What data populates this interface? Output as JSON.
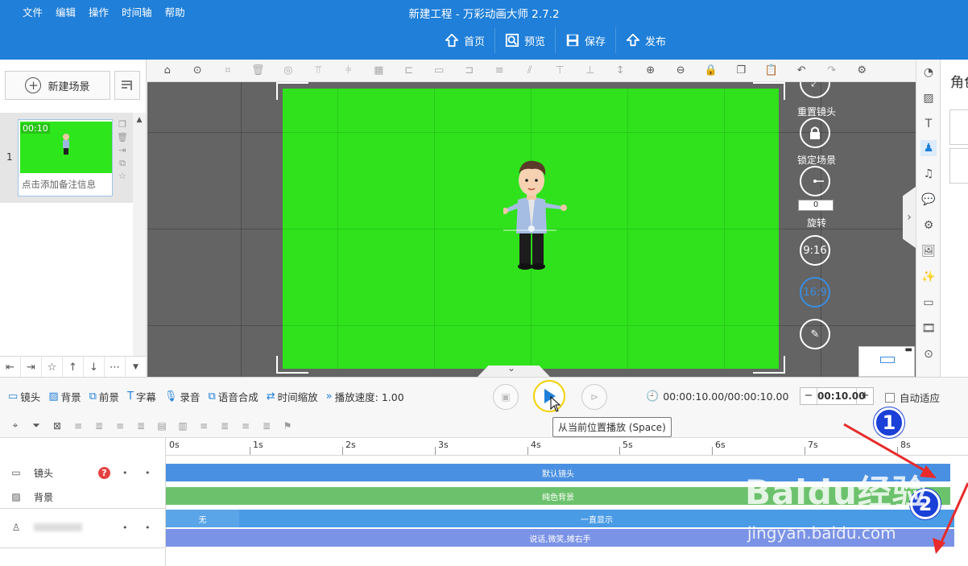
{
  "window": {
    "title": "新建工程 - 万彩动画大师 2.7.2",
    "menu": [
      "文件",
      "编辑",
      "操作",
      "时间轴",
      "帮助"
    ],
    "toolbar": [
      {
        "label": "首页",
        "icon": "home-icon"
      },
      {
        "label": "预览",
        "icon": "preview-icon"
      },
      {
        "label": "保存",
        "icon": "save-icon"
      },
      {
        "label": "发布",
        "icon": "publish-icon"
      }
    ]
  },
  "scene_panel": {
    "new_scene_label": "新建场景",
    "scenes": [
      {
        "index": "1",
        "duration": "00:10",
        "note_placeholder": "点击添加备注信息"
      }
    ]
  },
  "canvas": {
    "side_controls": [
      {
        "label": "重置镜头",
        "icon": "reset-camera-icon"
      },
      {
        "label": "锁定场景",
        "icon": "lock-icon"
      },
      {
        "label": "旋转",
        "icon": "rotate-icon",
        "value": "0"
      },
      {
        "label": "9:16",
        "icon": "aspect-9-16-icon"
      },
      {
        "label": "16:9",
        "icon": "aspect-16-9-icon"
      },
      {
        "label": "",
        "icon": "edit-icon"
      }
    ],
    "stage_color": "#2fe21c"
  },
  "right_panel": {
    "title": "角色"
  },
  "timeline_toolbar": {
    "tools": [
      {
        "label": "镜头",
        "icon": "camera-icon"
      },
      {
        "label": "背景",
        "icon": "background-icon"
      },
      {
        "label": "前景",
        "icon": "foreground-icon"
      },
      {
        "label": "字幕",
        "icon": "subtitle-icon"
      },
      {
        "label": "录音",
        "icon": "mic-icon"
      },
      {
        "label": "语音合成",
        "icon": "tts-icon"
      },
      {
        "label": "时间缩放",
        "icon": "time-scale-icon"
      },
      {
        "label": "播放速度: 1.00",
        "icon": "speed-icon"
      }
    ],
    "time_display": "00:00:10.00/00:00:10.00",
    "duration_value": "00:10.00",
    "autofit_label": "自动适应",
    "play_tooltip": "从当前位置播放 (Space)"
  },
  "timeline": {
    "ruler": [
      "0s",
      "1s",
      "2s",
      "3s",
      "4s",
      "5s",
      "6s",
      "7s",
      "8s"
    ],
    "tracks": [
      {
        "name": "镜头",
        "icon": "camera-icon",
        "bar_label": "默认镜头",
        "color": "#4a90e2"
      },
      {
        "name": "背景",
        "icon": "background-icon",
        "bar_label": "纯色背景",
        "color": "#6cc26c"
      },
      {
        "name": "",
        "icon": "character-icon",
        "bar_labels": [
          "无",
          "一直显示"
        ],
        "color": "#4a90e2"
      },
      {
        "name": "",
        "icon": "",
        "bar_label": "说话,微笑,摊右手",
        "color": "#7b93e6"
      }
    ]
  },
  "annotations": {
    "badge1": "1",
    "badge2": "2",
    "watermark": "Baidu经验",
    "watermark_url": "jingyan.baidu.com"
  },
  "colors": {
    "brand_blue": "#1f7fd9",
    "canvas_gray": "#646464",
    "annotation_red": "#e82a2a"
  }
}
